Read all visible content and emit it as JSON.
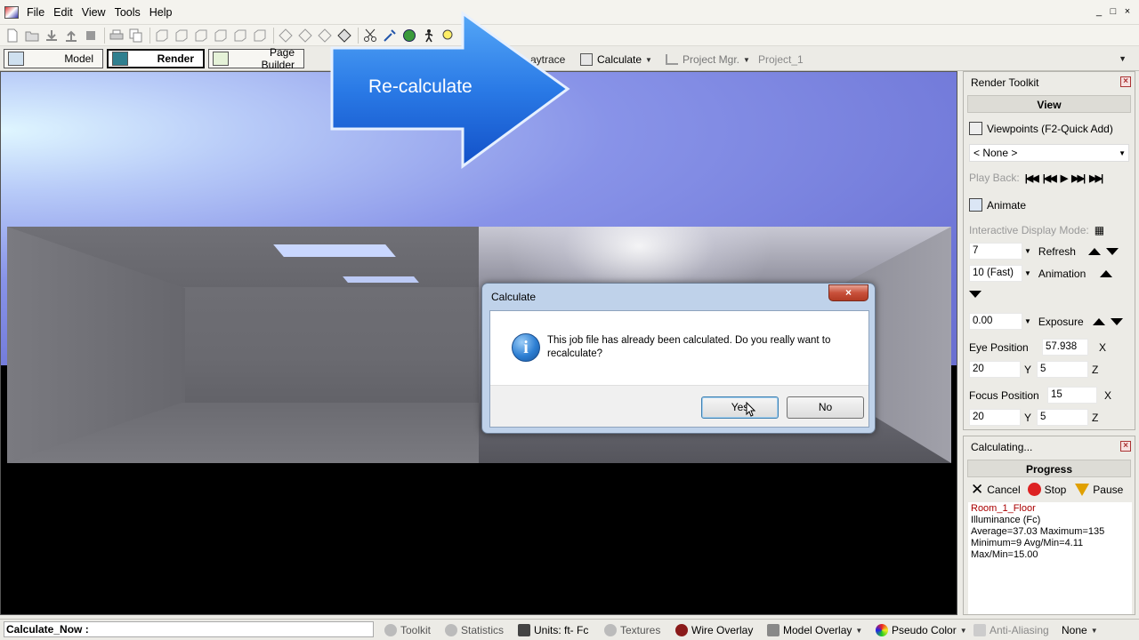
{
  "menu": [
    "File",
    "Edit",
    "View",
    "Tools",
    "Help"
  ],
  "window_controls": [
    "_",
    "□",
    "×"
  ],
  "toolbar_icons": [
    "new-icon",
    "open-icon",
    "save-icon",
    "upload-icon",
    "stop-square-icon",
    "print-icon",
    "copy-icon",
    "view-front-icon",
    "view-back-icon",
    "view-left-icon",
    "view-right-icon",
    "view-top-icon",
    "view-bottom-icon",
    "iso-1-icon",
    "iso-2-icon",
    "iso-3-icon",
    "iso-4-icon",
    "scissors-icon",
    "tools-icon",
    "globe-icon",
    "walk-icon",
    "zoom-icon",
    "pan-icon",
    "eye-icon",
    "fit-icon",
    "screen-icon",
    "sphere-icon"
  ],
  "modes": {
    "model": "Model",
    "render": "Render",
    "page_builder": "Page Builder",
    "raytrace": "aytrace",
    "calculate": "Calculate",
    "project_mgr": "Project Mgr.",
    "project_name": "Project_1"
  },
  "callout": {
    "text": "Re-calculate",
    "color_top": "#55a7f7",
    "color_bottom": "#1250c8"
  },
  "dialog": {
    "title": "Calculate",
    "close": "×",
    "icon": "i",
    "message": "This job file has already been calculated. Do you really want to recalculate?",
    "yes": "Yes",
    "no": "No"
  },
  "toolkit": {
    "title": "Render Toolkit",
    "section": "View",
    "viewpoints_label": "Viewpoints (F2-Quick Add)",
    "viewpoint_select": "< None >",
    "playback_label": "Play Back:",
    "animate_label": "Animate",
    "interactive_label": "Interactive Display Mode:",
    "refresh_value": "7",
    "refresh_label": "Refresh",
    "animation_value": "10 (Fast)",
    "animation_label": "Animation",
    "exposure_value": "0.00",
    "exposure_label": "Exposure",
    "eye_label": "Eye Position",
    "eye_x": "57.938",
    "eye_y": "20",
    "eye_z": "5",
    "focus_label": "Focus Position",
    "focus_x": "15",
    "focus_y": "20",
    "focus_z": "5",
    "x_label": "X",
    "y_label": "Y",
    "z_label": "Z"
  },
  "calc": {
    "title": "Calculating...",
    "section": "Progress",
    "cancel": "Cancel",
    "stop": "Stop",
    "pause": "Pause",
    "log": [
      "Room_1_Floor",
      "Illuminance (Fc)",
      "Average=37.03  Maximum=135",
      "Minimum=9  Avg/Min=4.11",
      "Max/Min=15.00"
    ]
  },
  "status": {
    "text": "Calculate_Now :",
    "toolkit": "Toolkit",
    "statistics": "Statistics",
    "units": "Units: ft- Fc",
    "textures": "Textures",
    "wire_overlay": "Wire Overlay",
    "model_overlay": "Model Overlay",
    "pseudo_color": "Pseudo Color",
    "anti_aliasing": "Anti-Aliasing",
    "aa_value": "None"
  }
}
